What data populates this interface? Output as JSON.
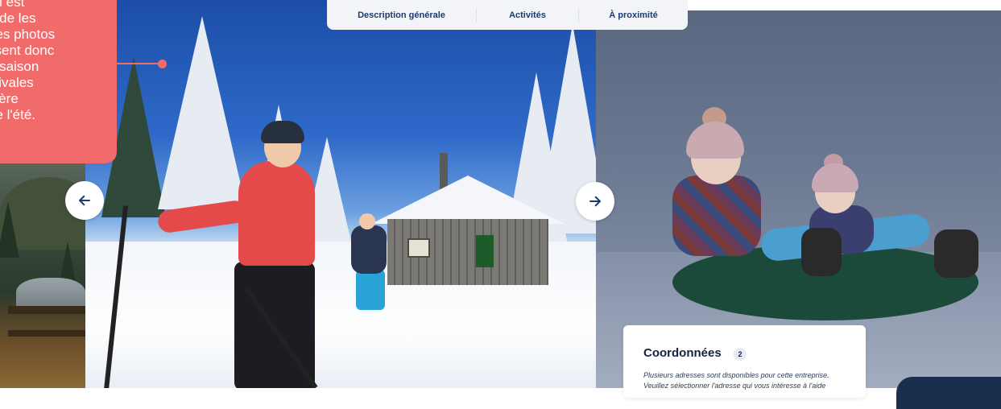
{
  "tooltip": {
    "text": "! Il est\ne de les\nLes photos\nssent donc\na saison\nstivales\nnière\n de l'été."
  },
  "tabs": [
    {
      "label": "Description générale"
    },
    {
      "label": "Activités"
    },
    {
      "label": "À proximité"
    }
  ],
  "carousel": {
    "prev_icon": "arrow-left-icon",
    "next_icon": "arrow-right-icon"
  },
  "contact": {
    "title": "Coordonnées",
    "count": "2",
    "text": "Plusieurs adresses sont disponibles pour cette entreprise. Veuillez sélectionner l'adresse qui vous intéresse à l'aide"
  },
  "colors": {
    "accent": "#f26b6b",
    "navy": "#1d3a70",
    "tab_bg": "#f2f4f7",
    "dark_pill": "#1a2e4e"
  }
}
